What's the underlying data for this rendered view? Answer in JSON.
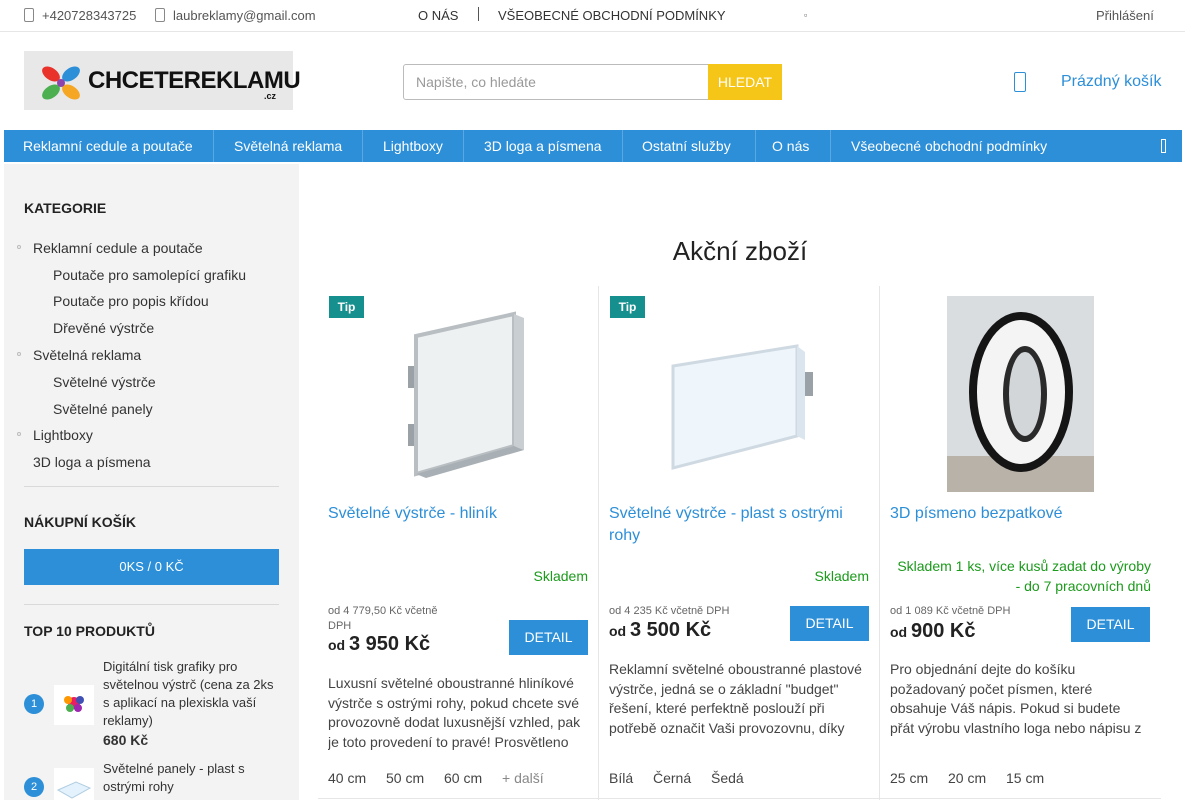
{
  "topbar": {
    "phone": "+420728343725",
    "email": "laubreklamy@gmail.com",
    "links": [
      "O NÁS",
      "VŠEOBECNÉ OBCHODNÍ PODMÍNKY"
    ],
    "login": "Přihlášení"
  },
  "header": {
    "logo_text": "CHCETEREKLAMU",
    "logo_suffix": ".cz",
    "search_placeholder": "Napište, co hledáte",
    "search_button": "HLEDAT",
    "cart_label": "Prázdný košík"
  },
  "nav": {
    "items": [
      "Reklamní cedule a poutače",
      "Světelná reklama",
      "Lightboxy",
      "3D loga a písmena",
      "Ostatní služby",
      "O nás",
      "Všeobecné obchodní podmínky"
    ]
  },
  "sidebar": {
    "categories_title": "KATEGORIE",
    "categories": [
      {
        "label": "Reklamní cedule a poutače",
        "level": 1
      },
      {
        "label": "Poutače pro samolepící grafiku",
        "level": 2
      },
      {
        "label": "Poutače pro popis křídou",
        "level": 2
      },
      {
        "label": "Dřevěné výstrče",
        "level": 2
      },
      {
        "label": "Světelná reklama",
        "level": 1
      },
      {
        "label": "Světelné výstrče",
        "level": 2
      },
      {
        "label": "Světelné panely",
        "level": 2
      },
      {
        "label": "Lightboxy",
        "level": 1
      },
      {
        "label": "3D loga a písmena",
        "level": 1
      }
    ],
    "cart_title": "NÁKUPNÍ KOŠÍK",
    "cart_summary": "0KS / 0 KČ",
    "top_title": "TOP 10 PRODUKTŮ",
    "top_products": [
      {
        "rank": "1",
        "name": "Digitální tisk grafiky pro světelnou výstrč (cena za 2ks s aplikací na plexiskla vaší reklamy)",
        "price": "680 Kč"
      },
      {
        "rank": "2",
        "name": "Světelné panely - plast s ostrými rohy",
        "price": ""
      }
    ]
  },
  "main": {
    "title": "Akční zboží",
    "products": [
      {
        "badge": "Tip",
        "name": "Světelné výstrče - hliník",
        "stock": "Skladem",
        "price_note": "od 4 779,50 Kč včetně DPH",
        "price_prefix": "od",
        "price": "3 950 Kč",
        "button": "DETAIL",
        "description": "Luxusní světelné oboustranné hliníkové výstrče s ostrými rohy, pokud chcete své provozovně dodat luxusnější vzhled, pak je toto provedení to pravé! Prosvětleno",
        "variants": [
          "40 cm",
          "50 cm",
          "60 cm",
          "+ další"
        ]
      },
      {
        "badge": "Tip",
        "name": "Světelné výstrče - plast s ostrými rohy",
        "stock": "Skladem",
        "price_note": "od 4 235 Kč včetně DPH",
        "price_prefix": "od",
        "price": "3 500 Kč",
        "button": "DETAIL",
        "description": "Reklamní světelné oboustranné plastové výstrče, jedná se o základní \"budget\" řešení, které perfektně poslouží při potřebě označit Vaši provozovnu, díky",
        "variants": [
          "Bílá",
          "Černá",
          "Šedá"
        ]
      },
      {
        "badge": "",
        "name": "3D písmeno bezpatkové",
        "stock": "Skladem 1 ks, více kusů zadat do výroby - do 7 pracovních dnů",
        "price_note": "od 1 089 Kč včetně DPH",
        "price_prefix": "od",
        "price": "900 Kč",
        "button": "DETAIL",
        "description": "Pro objednání dejte do košíku požadovaný počet písmen, které obsahuje Váš nápis. Pokud si budete přát výrobu vlastního loga nebo nápisu z",
        "variants": [
          "25 cm",
          "20 cm",
          "15 cm"
        ]
      }
    ]
  },
  "colors": {
    "accent": "#2c8fd8",
    "search_button": "#f5c518",
    "tip_badge": "#168f8f",
    "stock": "#1b9a1b"
  }
}
